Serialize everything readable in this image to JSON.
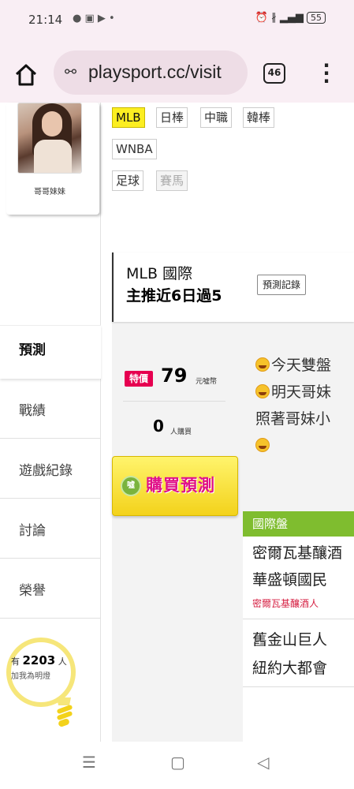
{
  "status_bar": {
    "time": "21:14",
    "battery": "55"
  },
  "browser": {
    "url": "playsport.cc/visit",
    "tab_count": "46"
  },
  "sidebar": {
    "avatar_name": "哥哥妹妹",
    "active_item": "預測",
    "items": [
      {
        "label": "戰績"
      },
      {
        "label": "遊戲紀錄"
      },
      {
        "label": "討論"
      },
      {
        "label": "榮譽"
      }
    ],
    "fans": {
      "prefix": "有",
      "count": "2203",
      "suffix": "人",
      "label": "加我為明燈"
    }
  },
  "main": {
    "tags": [
      {
        "label": "MLB",
        "active": true
      },
      {
        "label": "日棒"
      },
      {
        "label": "中職"
      },
      {
        "label": "韓棒"
      },
      {
        "label": "WNBA"
      },
      {
        "label": "足球"
      },
      {
        "label": "賽馬",
        "dim": true
      }
    ],
    "prediction": {
      "title": "MLB 國際",
      "subtitle": "主推近6日過5",
      "record_button": "預測記錄"
    },
    "price": {
      "badge": "特價",
      "amount": "79",
      "unit": "元噓幣",
      "buyers": "0",
      "buyers_unit": "人購買",
      "buy_button": "購買預測",
      "coin_label": "噓"
    },
    "description": [
      "今天雙盤",
      "明天哥妹",
      "照著哥妹小",
      ""
    ],
    "game": {
      "header": "國際盤",
      "matches": [
        {
          "team1": "密爾瓦基釀酒",
          "team2": "華盛頓國民",
          "pick": "密爾瓦基釀酒人"
        },
        {
          "team1": "舊金山巨人",
          "team2": "紐約大都會"
        }
      ]
    }
  },
  "colors": {
    "tag_active": "#fcee21",
    "badge": "#e60050",
    "buy_text": "#e0118a",
    "game_header": "#7fbd2f",
    "pick_text": "#d62244"
  },
  "icons": [
    "home-icon",
    "site-settings-icon",
    "more-vert-icon",
    "recents-icon",
    "home-circle-icon",
    "back-icon"
  ]
}
